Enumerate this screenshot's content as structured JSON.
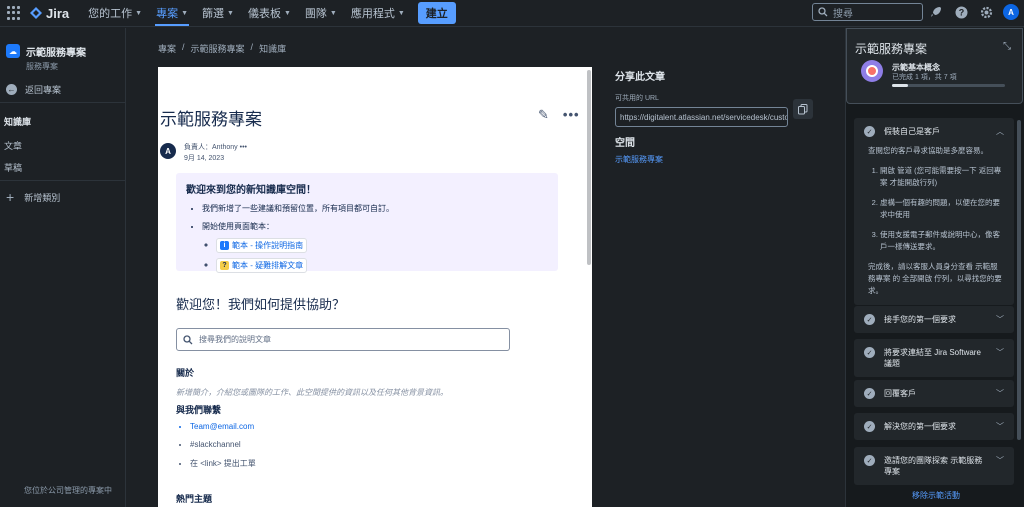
{
  "app": {
    "name": "Jira"
  },
  "topnav": {
    "items": [
      "您的工作",
      "專案",
      "篩選",
      "儀表板",
      "團隊",
      "應用程式"
    ],
    "active_index": 1,
    "create_label": "建立",
    "search_placeholder": "搜尋"
  },
  "sidebar": {
    "project_name": "示範服務專案",
    "project_type": "服務專案",
    "back_label": "返回專案",
    "section_title": "知識庫",
    "items": [
      "文章",
      "草稿"
    ],
    "add_category_label": "新增類別",
    "footer": "您位於公司管理的專案中"
  },
  "breadcrumb": [
    "專案",
    "示範服務專案",
    "知識庫"
  ],
  "article": {
    "title": "示範服務專案",
    "author_line": "負責人：Anthony",
    "date": "9月 14, 2023",
    "author_initial": "A",
    "panel_title": "歡迎來到您的新知識庫空間！",
    "bullets": [
      "我們新增了一些建議和預留位置，所有項目都可自訂。",
      "開始使用頁面範本："
    ],
    "templates": [
      "範本 - 操作說明指南",
      "範本 - 疑難排解文章"
    ],
    "welcome_heading": "歡迎您！我們如何提供協助？",
    "search_placeholder": "搜尋我們的說明文章",
    "about_heading": "關於",
    "about_text": "新增簡介，介紹您或團隊的工作、此空間提供的資訊以及任何其他背景資訊。",
    "contact_heading": "與我們聯繫",
    "contacts": [
      "Team@email.com",
      "#slackchannel",
      "在 <link> 提出工單"
    ],
    "topics_heading": "熱門主題"
  },
  "share": {
    "title": "分享此文章",
    "url_label": "可共用的 URL",
    "url": "https://digitalent.atlassian.net/servicedesk/customer",
    "space_title": "空間",
    "space_link": "示範服務專案"
  },
  "guide": {
    "title": "示範服務專案",
    "task_name": "示範基本概念",
    "progress_text": "已完成 1 項，共 7 項",
    "progress_fraction": 0.14,
    "steps": [
      {
        "label": "假裝自己是客戶",
        "expanded": true
      },
      {
        "label": "接手您的第一個要求"
      },
      {
        "label": "將要求連結至 Jira Software 議題"
      },
      {
        "label": "回覆客戶"
      },
      {
        "label": "解決您的第一個要求"
      },
      {
        "label": "邀請您的團隊探索 示範服務專案"
      }
    ],
    "step1_intro": "查閱您的客戶尋求協助是多麼容易。",
    "step1_list": [
      "開啟 管道 (您可能需要按一下 返回專案 才能開啟行列)",
      "虛構一個有趣的問題，以便在您的要求中使用",
      "使用支援電子郵件或說明中心，像客戶一樣傳送要求。"
    ],
    "step1_outro": "完成後，請以客服人員身分查看 示範服務專案 的 全部開啟 佇列，以尋找您的要求。",
    "remove_label": "移除示範活動"
  }
}
